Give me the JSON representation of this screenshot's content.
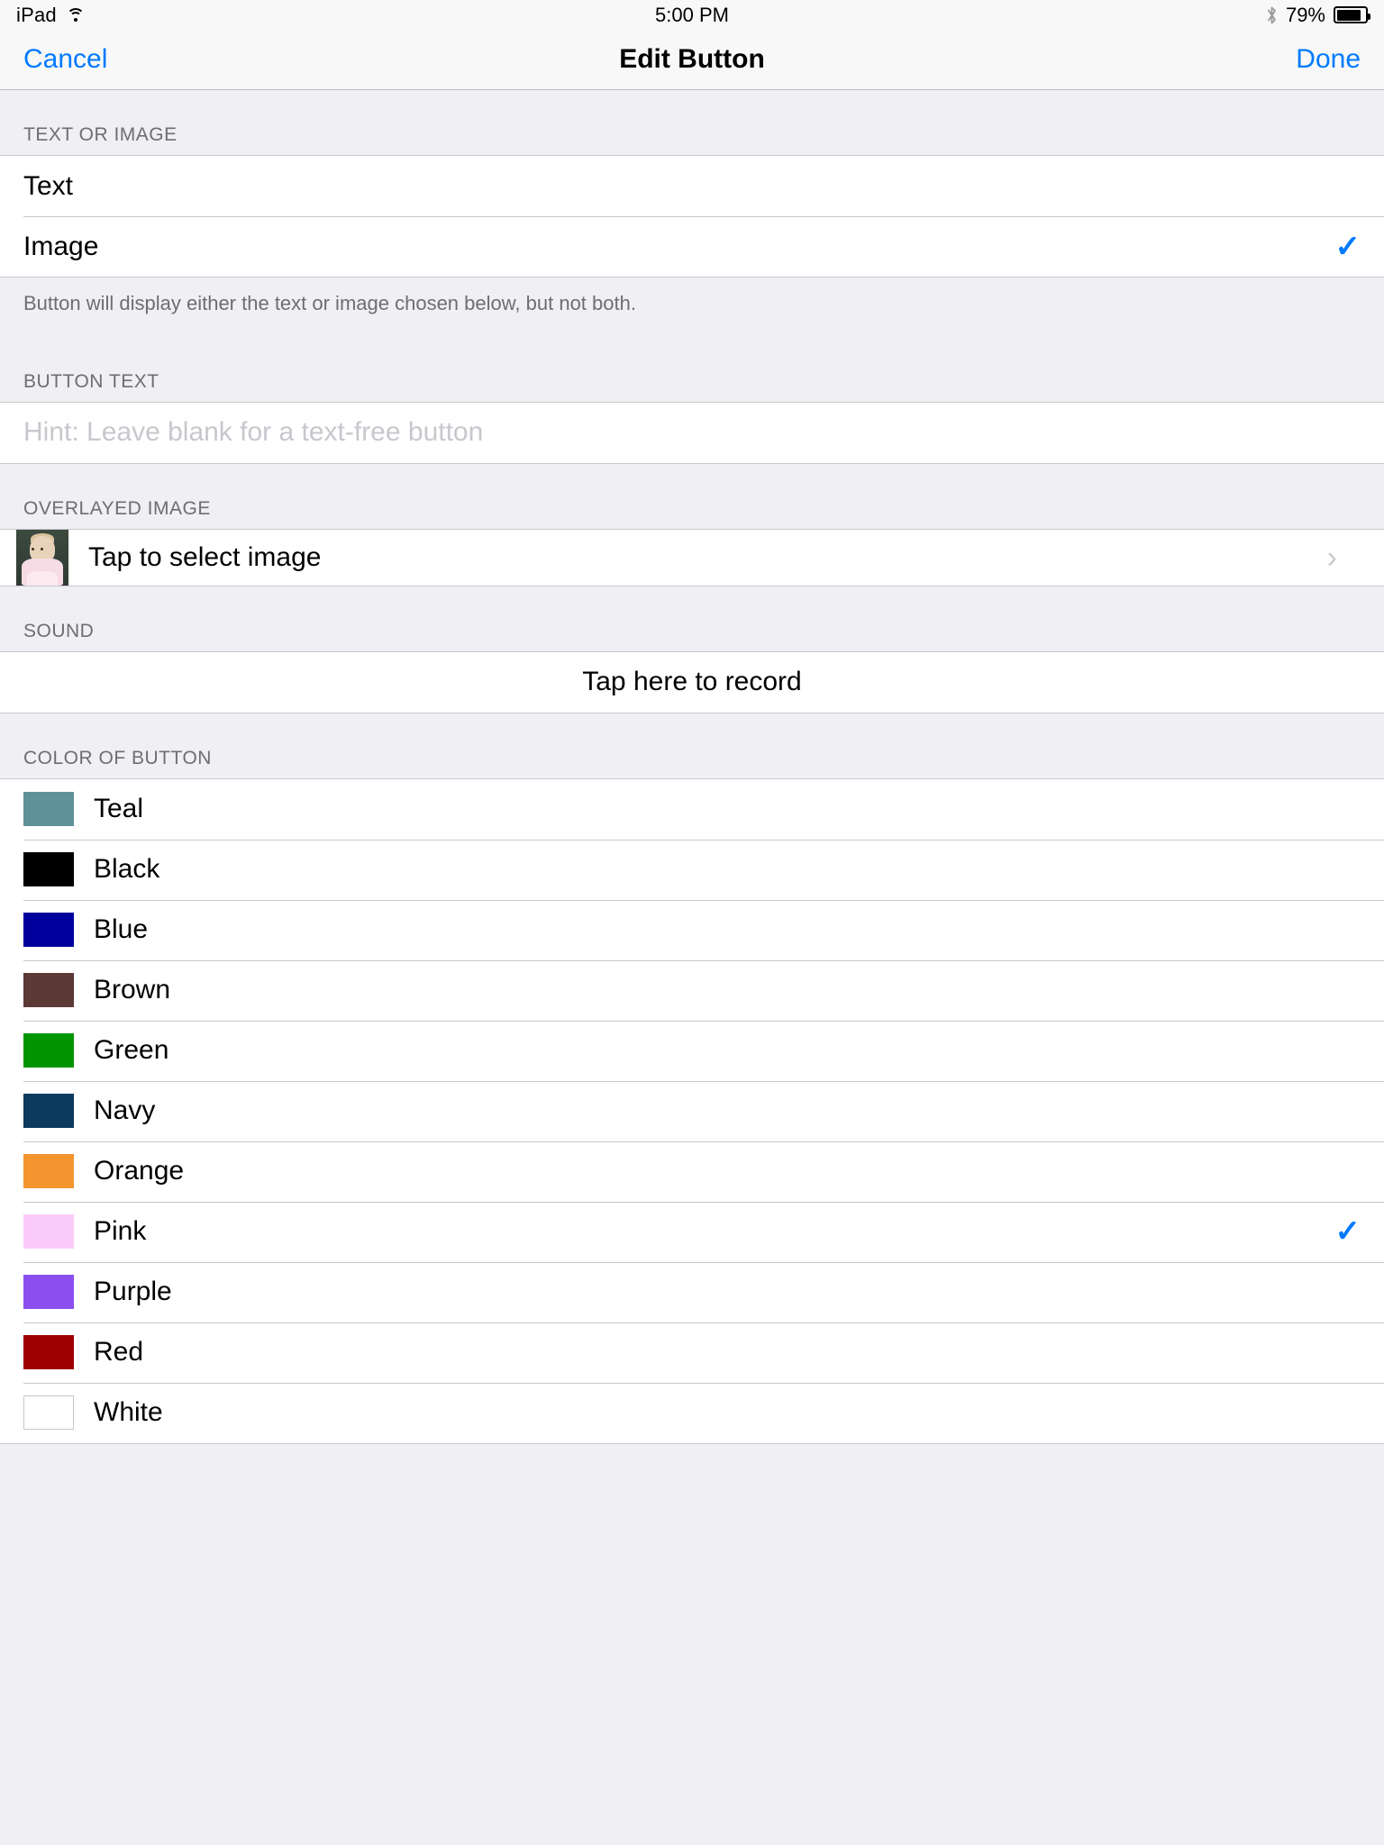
{
  "statusbar": {
    "carrier": "iPad",
    "wifi_icon": "wifi-icon",
    "time": "5:00 PM",
    "bluetooth_icon": "bluetooth-icon",
    "battery_percent": "79%",
    "battery_level": 79
  },
  "navbar": {
    "cancel_label": "Cancel",
    "title": "Edit Button",
    "done_label": "Done",
    "accent_color": "#007AFF"
  },
  "sections": {
    "text_or_image": {
      "header": "TEXT OR IMAGE",
      "options": [
        {
          "label": "Text",
          "selected": false
        },
        {
          "label": "Image",
          "selected": true
        }
      ],
      "footer": "Button will display either the text or image chosen below, but not both."
    },
    "button_text": {
      "header": "BUTTON TEXT",
      "value": "",
      "placeholder": "Hint: Leave blank for a text-free button"
    },
    "overlayed_image": {
      "header": "OVERLAYED IMAGE",
      "label": "Tap to select image",
      "thumbnail_alt": "baby-photo-thumbnail",
      "chevron_icon": "chevron-right-icon"
    },
    "sound": {
      "header": "SOUND",
      "label": "Tap here to record"
    },
    "color_of_button": {
      "header": "COLOR OF BUTTON",
      "colors": [
        {
          "label": "Teal",
          "hex": "#5F9199",
          "selected": false
        },
        {
          "label": "Black",
          "hex": "#000000",
          "selected": false
        },
        {
          "label": "Blue",
          "hex": "#00009C",
          "selected": false
        },
        {
          "label": "Brown",
          "hex": "#5C3836",
          "selected": false
        },
        {
          "label": "Green",
          "hex": "#019501",
          "selected": false
        },
        {
          "label": "Navy",
          "hex": "#0A3A5F",
          "selected": false
        },
        {
          "label": "Orange",
          "hex": "#F5952F",
          "selected": false
        },
        {
          "label": "Pink",
          "hex": "#FBCCFA",
          "selected": true
        },
        {
          "label": "Purple",
          "hex": "#8B4FF0",
          "selected": false
        },
        {
          "label": "Red",
          "hex": "#9E0000",
          "selected": false
        },
        {
          "label": "White",
          "hex": "#FFFFFF",
          "selected": false
        }
      ]
    }
  },
  "icons": {
    "checkmark": "✓",
    "chevron_right": "›"
  }
}
